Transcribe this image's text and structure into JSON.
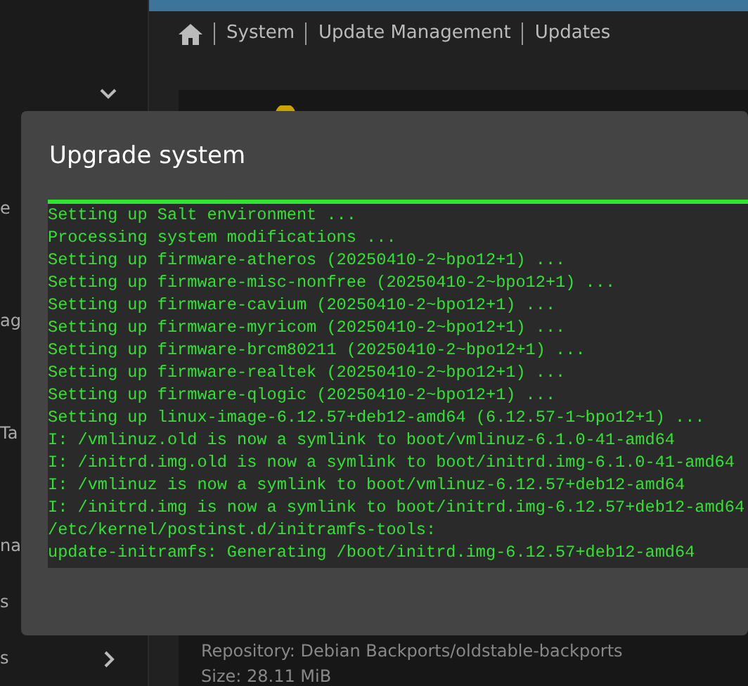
{
  "sidebar": {
    "items": [
      {
        "label": "e"
      },
      {
        "label": "ag"
      },
      {
        "label": "Ta"
      },
      {
        "label": "na"
      },
      {
        "label": "s"
      },
      {
        "label": "s"
      }
    ]
  },
  "breadcrumb": [
    "System",
    "Update Management",
    "Updates"
  ],
  "package": {
    "repository": "Repository: Debian Backports/oldstable-backports",
    "size": "Size: 28.11 MiB"
  },
  "dialog": {
    "title": "Upgrade system",
    "log": [
      "Setting up Salt environment ...",
      "Processing system modifications ...",
      "Setting up firmware-atheros (20250410-2~bpo12+1) ...",
      "Setting up firmware-misc-nonfree (20250410-2~bpo12+1) ...",
      "Setting up firmware-cavium (20250410-2~bpo12+1) ...",
      "Setting up firmware-myricom (20250410-2~bpo12+1) ...",
      "Setting up firmware-brcm80211 (20250410-2~bpo12+1) ...",
      "Setting up firmware-realtek (20250410-2~bpo12+1) ...",
      "Setting up firmware-qlogic (20250410-2~bpo12+1) ...",
      "Setting up linux-image-6.12.57+deb12-amd64 (6.12.57-1~bpo12+1) ...",
      "I: /vmlinuz.old is now a symlink to boot/vmlinuz-6.1.0-41-amd64",
      "I: /initrd.img.old is now a symlink to boot/initrd.img-6.1.0-41-amd64",
      "I: /vmlinuz is now a symlink to boot/vmlinuz-6.12.57+deb12-amd64",
      "I: /initrd.img is now a symlink to boot/initrd.img-6.12.57+deb12-amd64",
      "/etc/kernel/postinst.d/initramfs-tools:",
      "update-initramfs: Generating /boot/initrd.img-6.12.57+deb12-amd64"
    ]
  }
}
